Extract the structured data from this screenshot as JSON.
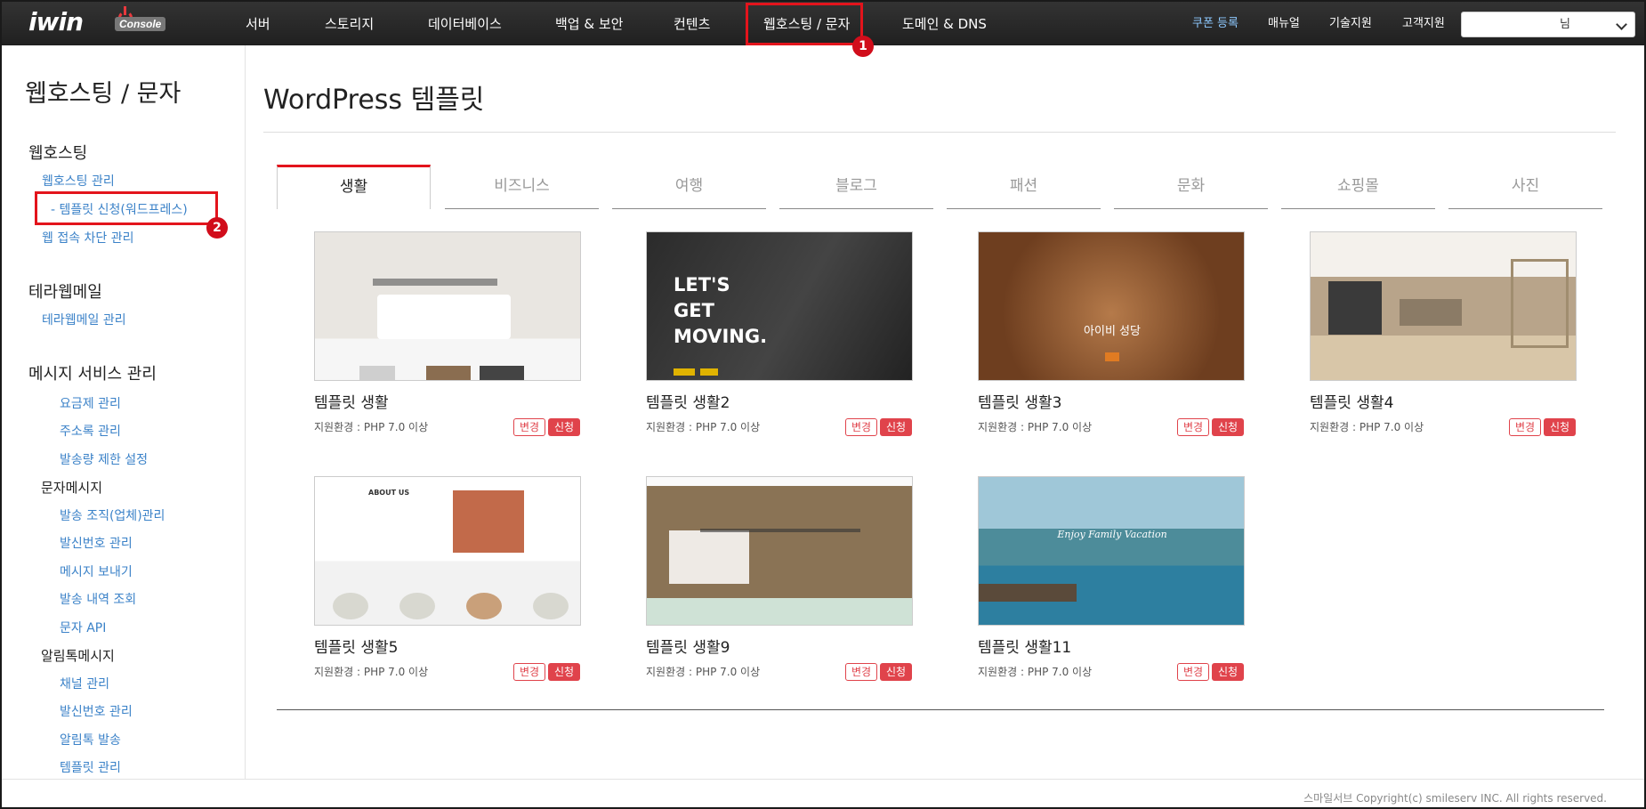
{
  "brand": {
    "logo": "iwin",
    "badge": "Console"
  },
  "nav": [
    "서버",
    "스토리지",
    "데이터베이스",
    "백업 & 보안",
    "컨텐츠",
    "웹호스팅 / 문자",
    "도메인 & DNS"
  ],
  "top_links": {
    "coupon": "쿠폰 등록",
    "manual": "매뉴얼",
    "tech": "기술지원",
    "support": "고객지원"
  },
  "user": {
    "suffix": "님"
  },
  "markers": {
    "one": "1",
    "two": "2"
  },
  "sidebar": {
    "title": "웹호스팅 / 문자",
    "hosting": {
      "heading": "웹호스팅",
      "items": [
        "웹호스팅 관리",
        "- 템플릿 신청(워드프레스)",
        "웹 접속 차단 관리"
      ]
    },
    "terra": {
      "heading": "테라웹메일",
      "items": [
        "테라웹메일 관리"
      ]
    },
    "message": {
      "heading": "메시지 서비스 관리",
      "items": [
        "요금제 관리",
        "주소록 관리",
        "발송량 제한 설정"
      ],
      "sms_heading": "문자메시지",
      "sms_items": [
        "발송 조직(업체)관리",
        "발신번호 관리",
        "메시지 보내기",
        "발송 내역 조회",
        "문자 API"
      ],
      "talk_heading": "알림톡메시지",
      "talk_items": [
        "채널 관리",
        "발신번호 관리",
        "알림톡 발송",
        "템플릿 관리"
      ]
    }
  },
  "main": {
    "title": "WordPress 템플릿",
    "tabs": [
      "생활",
      "비즈니스",
      "여행",
      "블로그",
      "패션",
      "문화",
      "쇼핑몰",
      "사진"
    ],
    "templates": [
      {
        "name": "템플릿 생활",
        "env": "지원환경 : PHP 7.0 이상"
      },
      {
        "name": "템플릿 생활2",
        "env": "지원환경 : PHP 7.0 이상"
      },
      {
        "name": "템플릿 생활3",
        "env": "지원환경 : PHP 7.0 이상"
      },
      {
        "name": "템플릿 생활4",
        "env": "지원환경 : PHP 7.0 이상"
      },
      {
        "name": "템플릿 생활5",
        "env": "지원환경 : PHP 7.0 이상"
      },
      {
        "name": "템플릿 생활9",
        "env": "지원환경 : PHP 7.0 이상"
      },
      {
        "name": "템플릿 생활11",
        "env": "지원환경 : PHP 7.0 이상"
      }
    ],
    "btn_change": "변경",
    "btn_apply": "신청",
    "thumb_text": {
      "t2": "LET'S\nGET\nMOVING.",
      "t3": "아이비 성당",
      "t5": "ABOUT US",
      "t7": "Enjoy Family Vacation"
    }
  },
  "footer": "스마일서브 Copyright(c) smileserv INC. All rights reserved.",
  "colors": {
    "accent_red": "#e3141c",
    "link_blue": "#3b82c8",
    "topbar": "#262626"
  }
}
